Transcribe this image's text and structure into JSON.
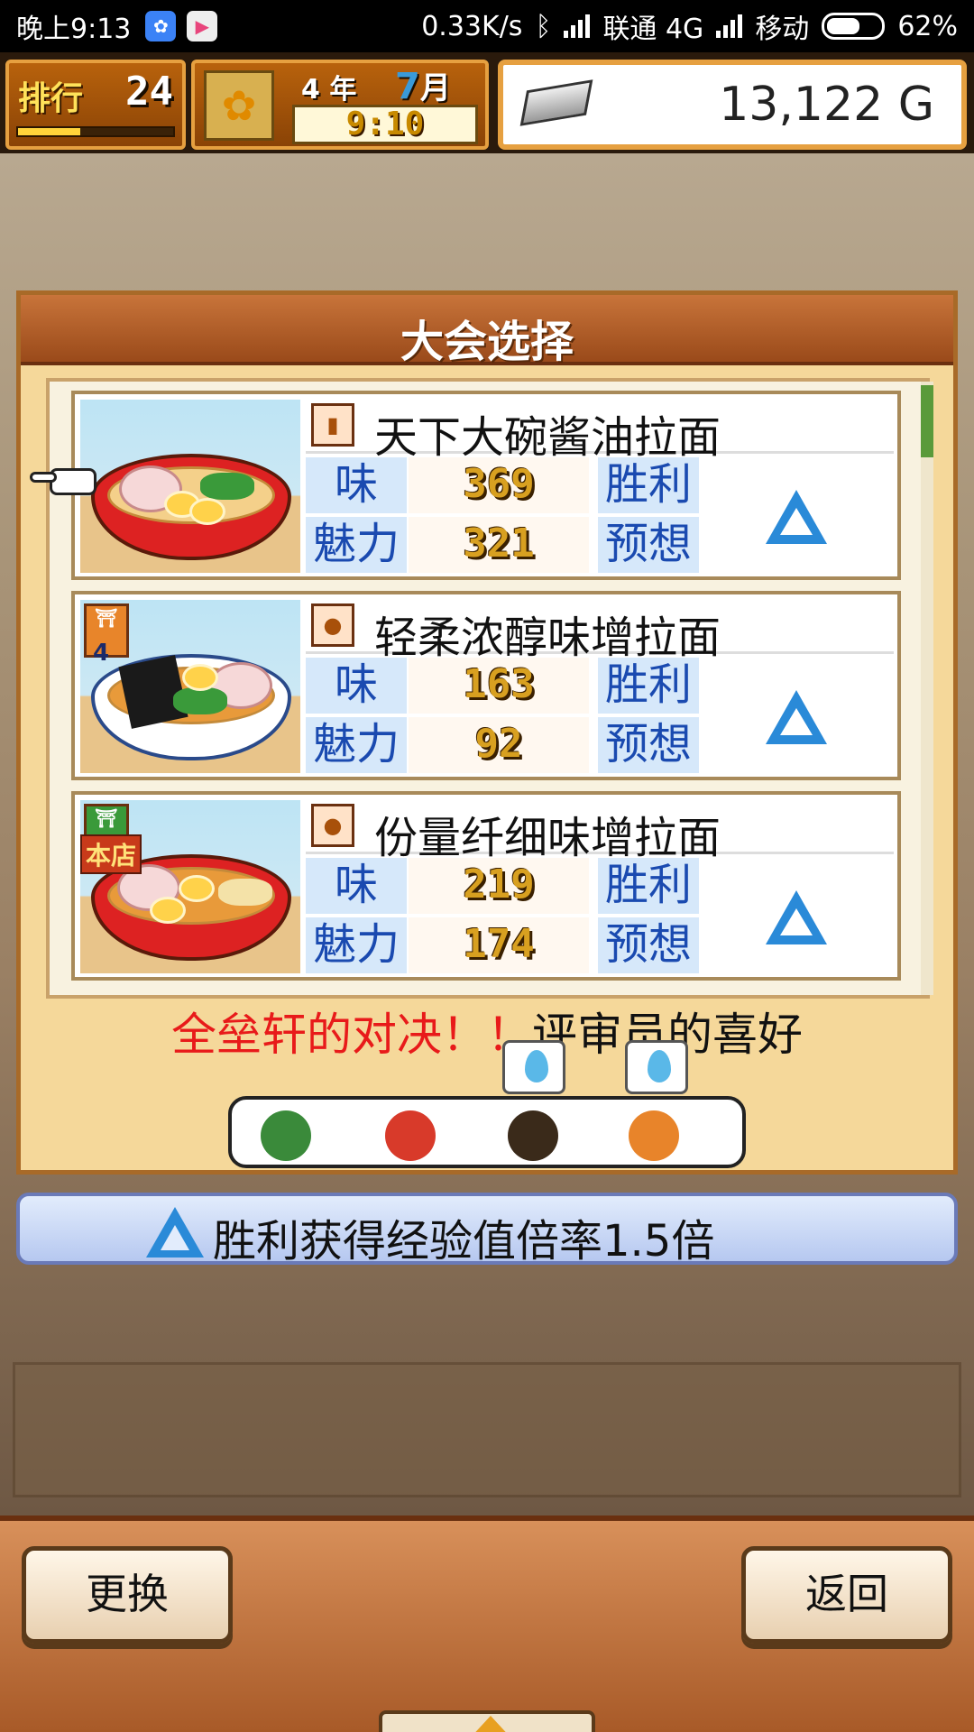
{
  "status_bar": {
    "time": "晚上9:13",
    "net_speed": "0.33K/s",
    "carrier1": "联通 4G",
    "carrier2": "移动",
    "battery": "62%"
  },
  "hud": {
    "rank_label": "排行",
    "rank_value": "24",
    "rank_progress": 0.4,
    "year": "4 年",
    "month_num": "7",
    "month_suffix": "月",
    "clock": "9:10",
    "money": "13,122 G"
  },
  "dialog": {
    "title": "大会选择",
    "items": [
      {
        "name": "天下大碗酱油拉面",
        "taste_label": "味",
        "taste": "369",
        "charm_label": "魅力",
        "charm": "321",
        "win1": "胜利",
        "win2": "预想"
      },
      {
        "name": "轻柔浓醇味增拉面",
        "taste_label": "味",
        "taste": "163",
        "charm_label": "魅力",
        "charm": "92",
        "win1": "胜利",
        "win2": "预想",
        "shop_num": "4"
      },
      {
        "name": "份量纤细味增拉面",
        "taste_label": "味",
        "taste": "219",
        "charm_label": "魅力",
        "charm": "174",
        "win1": "胜利",
        "win2": "预想",
        "badge": "本店"
      }
    ],
    "versus_red": "全垒轩的对决！！",
    "versus_dark": "评审员的喜好"
  },
  "bonus": {
    "text": "胜利获得经验值倍率1.5倍"
  },
  "footer": {
    "change": "更换",
    "back": "返回"
  }
}
